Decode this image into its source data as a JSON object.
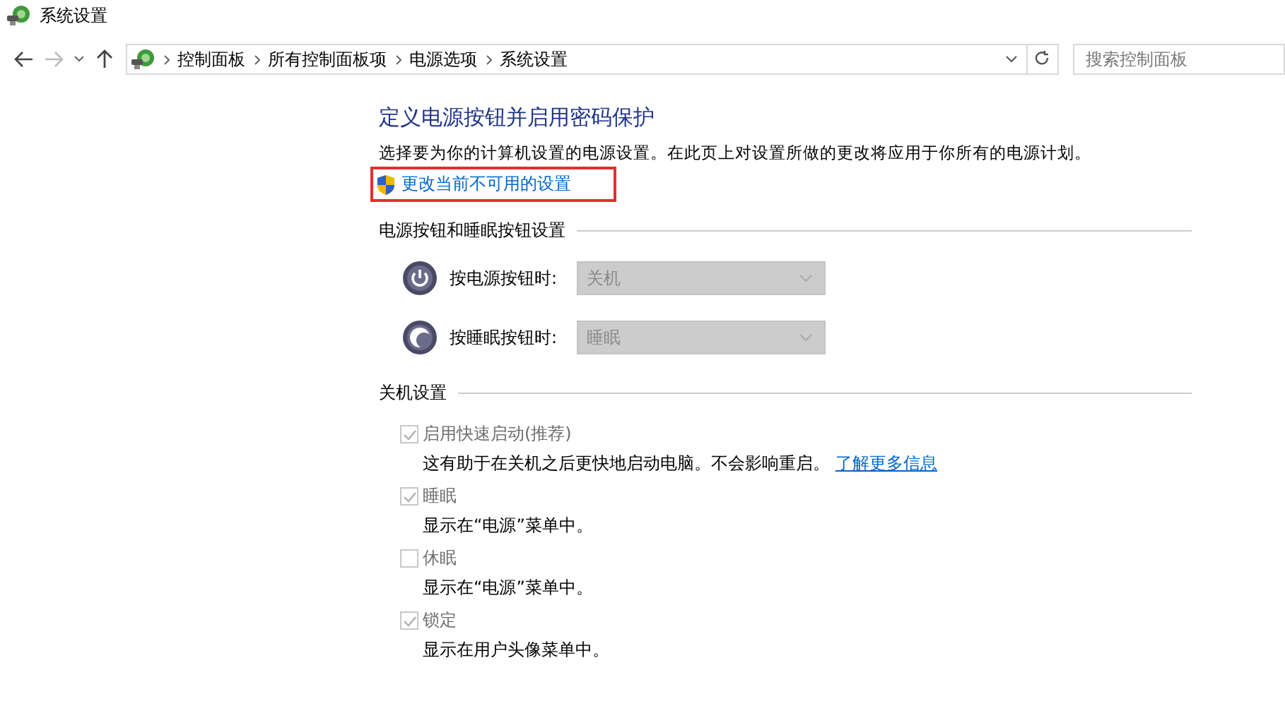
{
  "window": {
    "title": "系统设置"
  },
  "nav": {
    "back_disabled": false,
    "forward_disabled": true,
    "breadcrumbs": [
      "控制面板",
      "所有控制面板项",
      "电源选项",
      "系统设置"
    ],
    "search": {
      "placeholder": "搜索控制面板"
    }
  },
  "heading": "定义电源按钮并启用密码保护",
  "description": "选择要为你的计算机设置的电源设置。在此页上对设置所做的更改将应用于你所有的电源计划。",
  "admin_link": {
    "label": "更改当前不可用的设置",
    "highlighted": true
  },
  "button_section": {
    "title": "电源按钮和睡眠按钮设置",
    "rows": [
      {
        "kind": "power",
        "label": "按电源按钮时:",
        "value": "关机",
        "disabled": true
      },
      {
        "kind": "sleep",
        "label": "按睡眠按钮时:",
        "value": "睡眠",
        "disabled": true
      }
    ]
  },
  "shutdown_section": {
    "title": "关机设置",
    "options": [
      {
        "label": "启用快速启动(推荐)",
        "checked": true,
        "disabled": true,
        "description": "这有助于在关机之后更快地启动电脑。不会影响重启。",
        "link": "了解更多信息"
      },
      {
        "label": "睡眠",
        "checked": true,
        "disabled": true,
        "description": "显示在“电源”菜单中。"
      },
      {
        "label": "休眠",
        "checked": false,
        "disabled": true,
        "description": "显示在“电源”菜单中。"
      },
      {
        "label": "锁定",
        "checked": true,
        "disabled": true,
        "description": "显示在用户头像菜单中。"
      }
    ]
  }
}
